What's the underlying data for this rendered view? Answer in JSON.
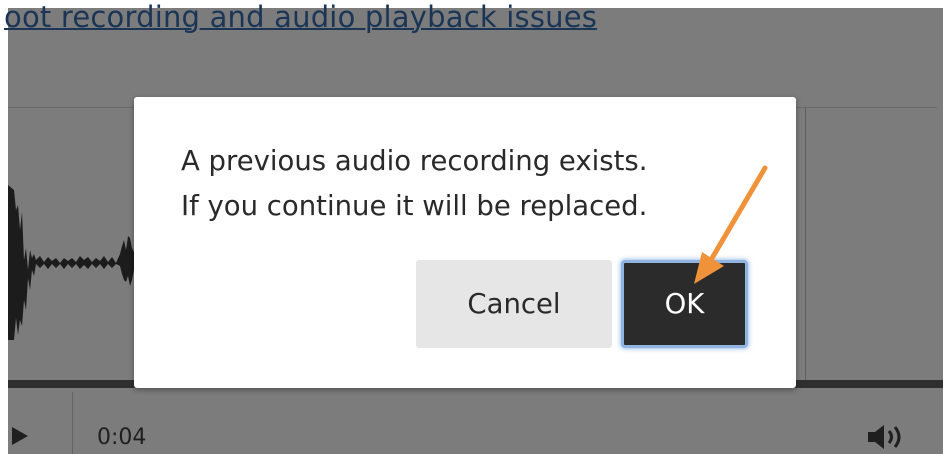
{
  "page": {
    "help_link": "oot recording and audio playback issues"
  },
  "player": {
    "time": "0:04",
    "play_icon": "play-icon",
    "volume_icon": "volume-icon"
  },
  "dialog": {
    "message_line_1": "A previous audio recording exists.",
    "message_line_2": "If you continue it will be replaced.",
    "cancel_label": "Cancel",
    "ok_label": "OK"
  },
  "annotation": {
    "arrow_color": "#f0923a",
    "arrow_icon": "arrow-pointer-icon"
  },
  "colors": {
    "overlay": "#7c7c7c",
    "ok_button_bg": "#2b2b2b",
    "ok_focus_ring": "#8fb4e2",
    "cancel_button_bg": "#e6e6e6",
    "link": "#1a3555"
  }
}
